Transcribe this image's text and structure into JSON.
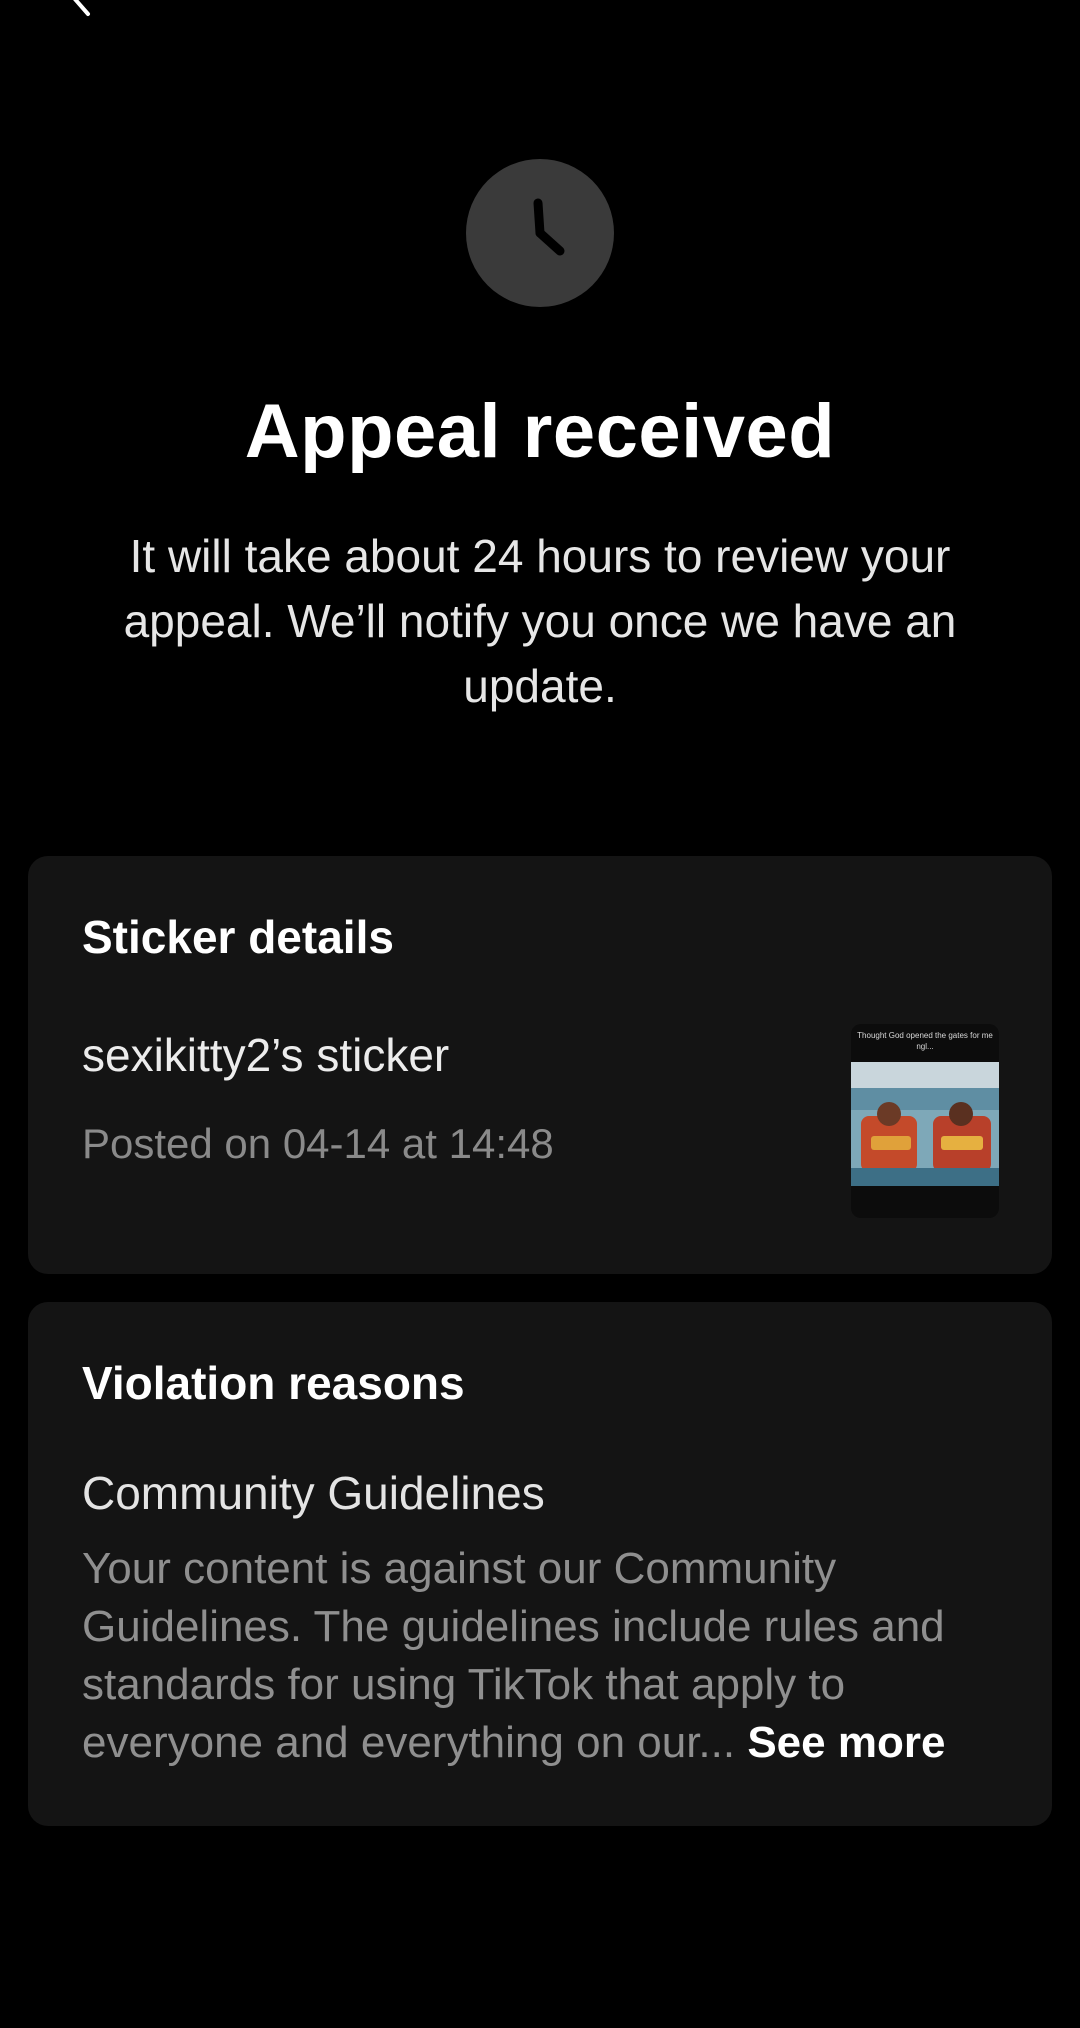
{
  "header": {
    "back_icon": "chevron-left-icon"
  },
  "status": {
    "icon": "clock-icon",
    "title": "Appeal received",
    "message": "It will take about 24 hours to review your appeal. We’ll notify you once we have an update."
  },
  "sticker_details": {
    "heading": "Sticker details",
    "name": "sexikitty2’s sticker",
    "posted": "Posted on 04-14 at 14:48",
    "thumbnail_caption": "Thought God opened the gates for me ngl..."
  },
  "violation": {
    "heading": "Violation reasons",
    "guideline_name": "Community Guidelines",
    "description": "Your content is against our Community Guidelines. The guidelines include rules and standards for using TikTok that apply to everyone and everything on our...",
    "see_more_label": " See more"
  },
  "colors": {
    "background": "#000000",
    "card": "#141414",
    "icon_circle": "#3a3a3a",
    "secondary_text": "#8f8f8f"
  }
}
